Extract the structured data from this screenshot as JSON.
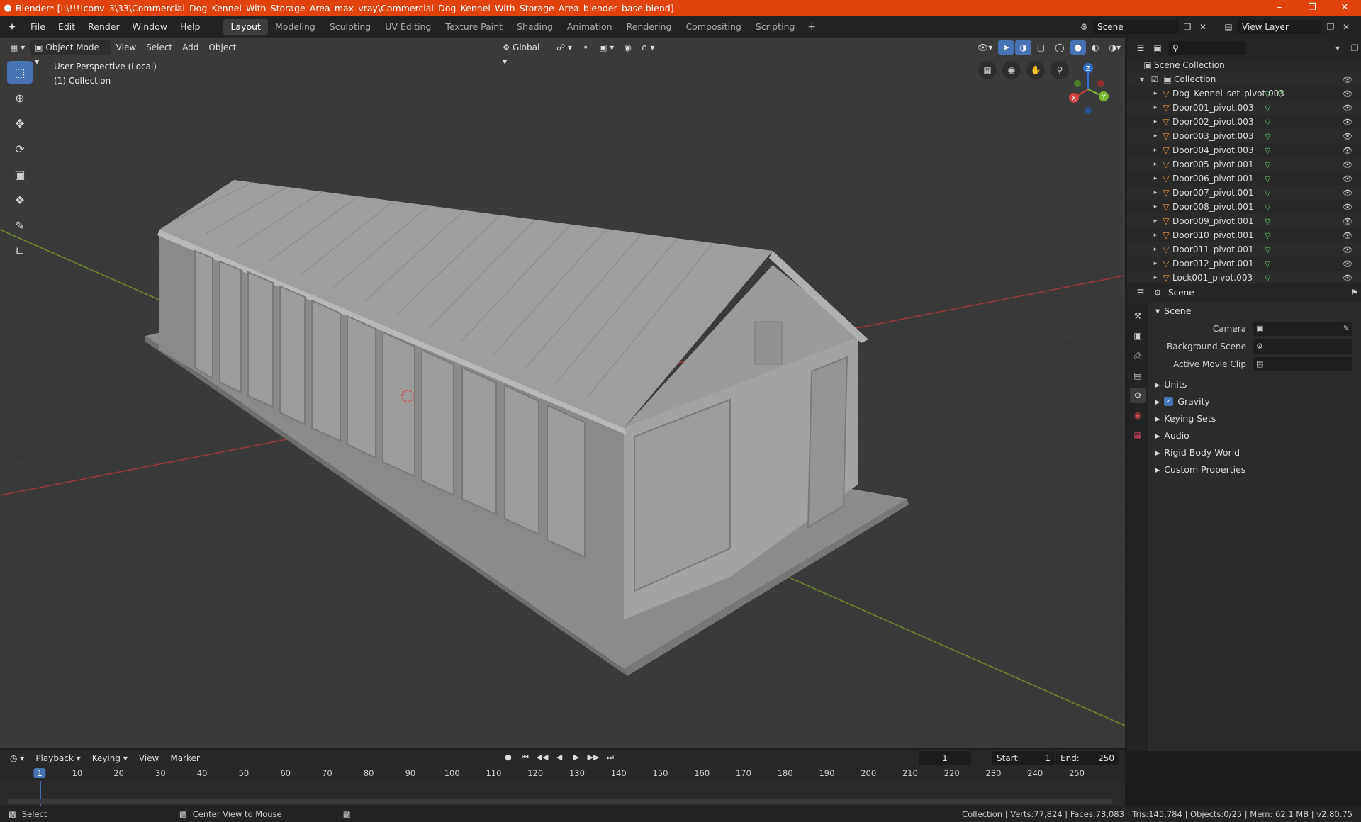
{
  "window": {
    "title": "Blender* [I:\\!!!!conv_3\\33\\Commercial_Dog_Kennel_With_Storage_Area_max_vray\\Commercial_Dog_Kennel_With_Storage_Area_blender_base.blend]",
    "minimize": "–",
    "maximize": "❐",
    "close": "✕"
  },
  "menu": [
    "File",
    "Edit",
    "Render",
    "Window",
    "Help"
  ],
  "workspaces": [
    "Layout",
    "Modeling",
    "Sculpting",
    "UV Editing",
    "Texture Paint",
    "Shading",
    "Animation",
    "Rendering",
    "Compositing",
    "Scripting"
  ],
  "active_workspace": "Layout",
  "scene_name": "Scene",
  "view_layer": "View Layer",
  "viewport": {
    "mode": "Object Mode",
    "menus": [
      "View",
      "Select",
      "Add",
      "Object"
    ],
    "orientation": "Global",
    "info_line1": "User Perspective (Local)",
    "info_line2": "(1) Collection",
    "gizmo_axes": [
      "X",
      "Y",
      "Z"
    ]
  },
  "outliner": {
    "root": "Scene Collection",
    "collection": "Collection",
    "objects": [
      "Dog_Kennel_set_pivot.003",
      "Door001_pivot.003",
      "Door002_pivot.003",
      "Door003_pivot.003",
      "Door004_pivot.003",
      "Door005_pivot.001",
      "Door006_pivot.001",
      "Door007_pivot.001",
      "Door008_pivot.001",
      "Door009_pivot.001",
      "Door010_pivot.001",
      "Door011_pivot.001",
      "Door012_pivot.001",
      "Lock001_pivot.003"
    ]
  },
  "properties": {
    "header": "Scene",
    "panel": "Scene",
    "fields": [
      {
        "label": "Camera",
        "value": ""
      },
      {
        "label": "Background Scene",
        "value": ""
      },
      {
        "label": "Active Movie Clip",
        "value": ""
      }
    ],
    "subpanels": [
      "Units",
      "Gravity",
      "Keying Sets",
      "Audio",
      "Rigid Body World",
      "Custom Properties"
    ]
  },
  "timeline": {
    "menus": [
      "Playback",
      "Keying",
      "View",
      "Marker"
    ],
    "current_frame": "1",
    "start_label": "Start:",
    "start": "1",
    "end_label": "End:",
    "end": "250",
    "ticks": [
      "1",
      "10",
      "20",
      "30",
      "40",
      "50",
      "60",
      "70",
      "80",
      "90",
      "100",
      "110",
      "120",
      "130",
      "140",
      "150",
      "160",
      "170",
      "180",
      "190",
      "200",
      "210",
      "220",
      "230",
      "240",
      "250"
    ]
  },
  "status": {
    "left_action": "Select",
    "mid_action": "Center View to Mouse",
    "stats": "Collection | Verts:77,824 | Faces:73,083 | Tris:145,784 | Objects:0/25 | Mem: 62.1 MB | v2.80.75"
  },
  "colors": {
    "title_bar": "#e1410b",
    "accent_blue": "#4772b3",
    "object_orange": "#e8923b",
    "mesh_green": "#5fd06b"
  }
}
